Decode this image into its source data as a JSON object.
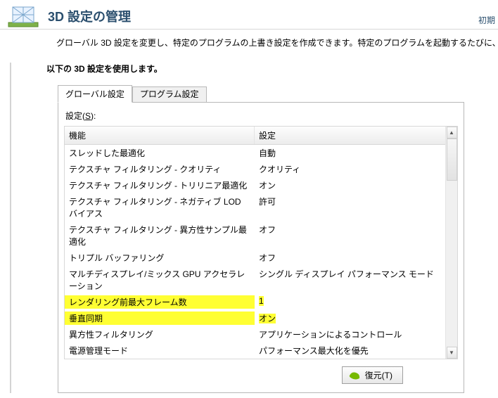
{
  "header": {
    "title": "3D 設定の管理",
    "restore_default_link": "初期"
  },
  "description": "グローバル 3D 設定を変更し、特定のプログラムの上書き設定を作成できます。特定のプログラムを起動するたびに、上書き設定が自動",
  "section_label": "以下の 3D 設定を使用します。",
  "tabs": {
    "global": "グローバル設定",
    "program": "プログラム設定"
  },
  "settings_caption_prefix": "設定(",
  "settings_caption_key": "S",
  "settings_caption_suffix": "):",
  "table": {
    "col_feature": "機能",
    "col_setting": "設定",
    "rows": [
      {
        "feature": "スレッドした最適化",
        "setting": "自動",
        "hl": false
      },
      {
        "feature": "テクスチャ フィルタリング - クオリティ",
        "setting": "クオリティ",
        "hl": false
      },
      {
        "feature": "テクスチャ フィルタリング - トリリニア最適化",
        "setting": "オン",
        "hl": false
      },
      {
        "feature": "テクスチャ フィルタリング - ネガティブ LOD バイアス",
        "setting": "許可",
        "hl": false
      },
      {
        "feature": "テクスチャ フィルタリング - 異方性サンプル最適化",
        "setting": "オフ",
        "hl": false
      },
      {
        "feature": "トリプル バッファリング",
        "setting": "オフ",
        "hl": false
      },
      {
        "feature": "マルチディスプレイ/ミックス GPU アクセラレーション",
        "setting": "シングル ディスプレイ パフォーマンス モード",
        "hl": false
      },
      {
        "feature": "レンダリング前最大フレーム数",
        "setting": "1",
        "hl": true
      },
      {
        "feature": "垂直同期",
        "setting": "オン",
        "hl": true
      },
      {
        "feature": "異方性フィルタリング",
        "setting": "アプリケーションによるコントロール",
        "hl": false
      },
      {
        "feature": "電源管理モード",
        "setting": "パフォーマンス最大化を優先",
        "hl": false
      }
    ]
  },
  "restore_button": "復元(T)"
}
